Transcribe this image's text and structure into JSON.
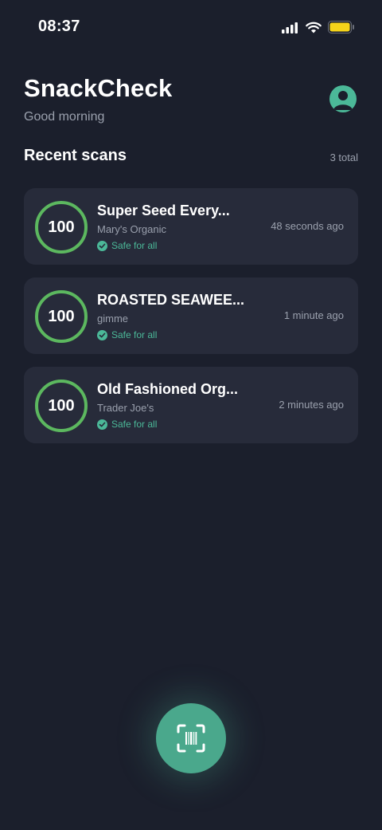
{
  "status_bar": {
    "time": "08:37",
    "icons": [
      "cellular-signal-icon",
      "wifi-icon",
      "battery-icon"
    ],
    "battery_color": "#f5d31a"
  },
  "header": {
    "title": "SnackCheck",
    "greeting": "Good morning",
    "avatar_icon": "user-avatar-icon"
  },
  "recent": {
    "title": "Recent scans",
    "count": "3 total",
    "items": [
      {
        "score": "100",
        "name": "Super Seed Every...",
        "brand": "Mary's Organic",
        "status": "Safe for all",
        "time": "48 seconds ago"
      },
      {
        "score": "100",
        "name": "ROASTED SEAWEE...",
        "brand": "gimme",
        "status": "Safe for all",
        "time": "1 minute ago"
      },
      {
        "score": "100",
        "name": "Old Fashioned Org...",
        "brand": "Trader Joe's",
        "status": "Safe for all",
        "time": "2 minutes ago"
      }
    ]
  },
  "scan_button": {
    "icon": "barcode-scan-icon"
  },
  "colors": {
    "background": "#1b1f2c",
    "card": "#272b3a",
    "accent": "#4bb898",
    "score_ring": "#5cb85f"
  }
}
